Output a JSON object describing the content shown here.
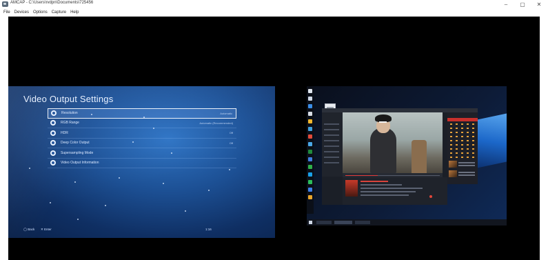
{
  "window": {
    "title": "AMCAP - C:\\Users\\rvdpn\\Documents\\725456",
    "minimize_glyph": "–",
    "maximize_glyph": "▢",
    "close_glyph": "✕"
  },
  "menu": [
    "File",
    "Devices",
    "Options",
    "Capture",
    "Help"
  ],
  "ps4": {
    "title": "Video Output Settings",
    "items": [
      {
        "label": "Resolution",
        "value": "Automatic",
        "icon": "settings-circle-icon",
        "selected": true
      },
      {
        "label": "RGB Range",
        "value": "Automatic (Recommended)",
        "icon": "settings-circle-icon"
      },
      {
        "label": "HDR",
        "value": "Off",
        "icon": "settings-circle-icon"
      },
      {
        "label": "Deep Color Output",
        "value": "Off",
        "icon": "settings-circle-icon"
      },
      {
        "label": "Supersampling Mode",
        "value": "",
        "icon": "settings-circle-icon"
      },
      {
        "label": "Video Output Information",
        "value": "",
        "icon": "settings-circle-icon"
      }
    ],
    "footer": {
      "back": "Back",
      "enter": "Enter",
      "status": "1:16"
    }
  },
  "desktop": {
    "player_title": "",
    "clock": "",
    "progress": 0.34,
    "colors": {
      "accent": "#e23b3b",
      "panel": "#1b1f27"
    }
  }
}
